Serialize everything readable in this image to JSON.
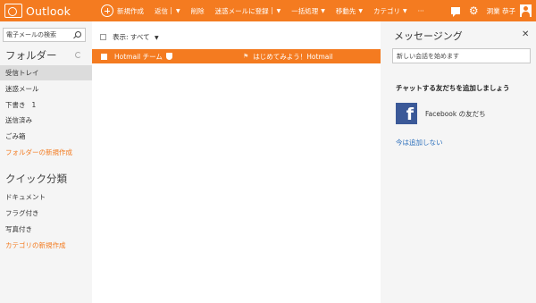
{
  "app": {
    "name": "Outlook"
  },
  "toolbar": {
    "new_label": "新規作成",
    "reply_label": "返信",
    "delete_label": "削除",
    "junk_label": "迷惑メールに登録",
    "sweep_label": "一括処理",
    "move_label": "移動先",
    "category_label": "カテゴリ",
    "more_label": "···"
  },
  "user": {
    "name": "洞業 恭子"
  },
  "search": {
    "placeholder": "電子メールの検索"
  },
  "folders": {
    "title": "フォルダー",
    "items": [
      {
        "label": "受信トレイ",
        "count": "",
        "selected": true
      },
      {
        "label": "迷惑メール",
        "count": ""
      },
      {
        "label": "下書き",
        "count": "1"
      },
      {
        "label": "送信済み",
        "count": ""
      },
      {
        "label": "ごみ箱",
        "count": ""
      }
    ],
    "new_folder_label": "フォルダーの新規作成"
  },
  "quick_views": {
    "title": "クイック分類",
    "items": [
      {
        "label": "ドキュメント"
      },
      {
        "label": "フラグ付き"
      },
      {
        "label": "写真付き"
      }
    ],
    "new_category_label": "カテゴリの新規作成"
  },
  "message_list": {
    "filter_label": "表示: すべて",
    "messages": [
      {
        "sender": "Hotmail チーム",
        "subject": "はじめてみよう！Hotmail",
        "selected": true
      }
    ]
  },
  "messaging": {
    "title": "メッセージング",
    "input_placeholder": "新しい会話を始めます",
    "add_friends_title": "チャットする友だちを追加しましょう",
    "facebook_label": "Facebook の友だち",
    "skip_label": "今は追加しない"
  },
  "colors": {
    "accent": "#f47b20",
    "link": "#2a6ebb",
    "facebook": "#3b5998"
  }
}
